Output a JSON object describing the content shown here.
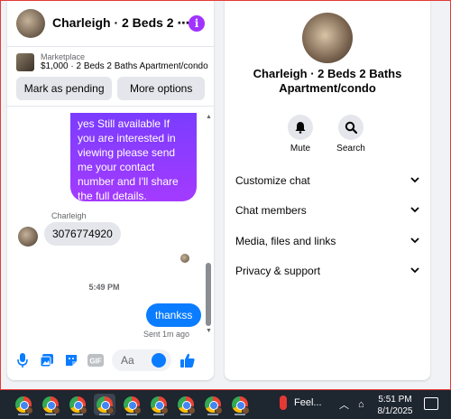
{
  "chat": {
    "title": "Charleigh · 2 Beds 2 ⋯",
    "marketplace": {
      "label": "Marketplace",
      "listing": "$1,000 · 2 Beds 2 Baths Apartment/condo",
      "mark_pending": "Mark as pending",
      "more_options": "More options"
    },
    "messages": {
      "outgoing_text": "yes Still available If you are interested in viewing please send me your contact number and I'll share the full details.",
      "sender_name": "Charleigh",
      "incoming_text": "3076774920",
      "time_separator": "5:49 PM",
      "outgoing_reply": "thankss",
      "sent_status": "Sent 1m ago"
    },
    "composer": {
      "placeholder": "Aa"
    }
  },
  "info": {
    "title": "Charleigh · 2 Beds 2 Baths Apartment/condo",
    "actions": [
      {
        "label": "Mute",
        "icon": "bell-icon"
      },
      {
        "label": "Search",
        "icon": "search-icon"
      }
    ],
    "menu": [
      {
        "label": "Customize chat"
      },
      {
        "label": "Chat members"
      },
      {
        "label": "Media, files and links"
      },
      {
        "label": "Privacy & support"
      }
    ]
  },
  "taskbar": {
    "weather": "Feel...",
    "time": "5:51 PM",
    "date": "8/1/2025"
  },
  "colors": {
    "accent": "#0a7cff",
    "purple": "#a033ff",
    "bubble_gray": "#e4e6eb",
    "taskbar": "#1e2630"
  }
}
